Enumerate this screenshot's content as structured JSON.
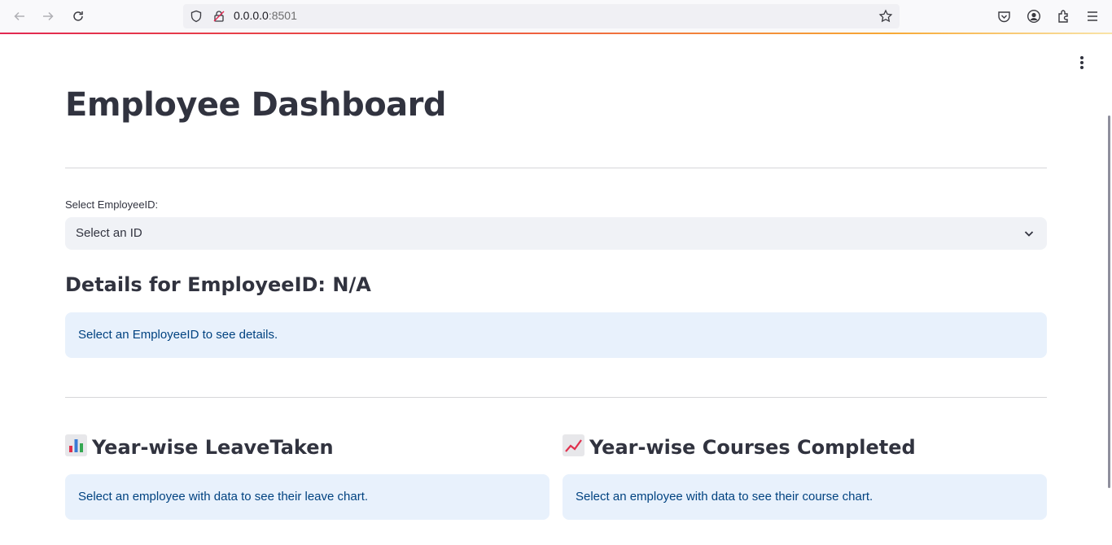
{
  "browser": {
    "url_host": "0.0.0.0",
    "url_port": ":8501"
  },
  "page": {
    "title": "Employee Dashboard",
    "select_label": "Select EmployeeID:",
    "select_value": "Select an ID",
    "details_heading": "Details for EmployeeID: N/A",
    "details_info": "Select an EmployeeID to see details.",
    "leave_heading": "Year-wise LeaveTaken",
    "leave_info": "Select an employee with data to see their leave chart.",
    "courses_heading": "Year-wise Courses Completed",
    "courses_info": "Select an employee with data to see their course chart."
  },
  "icons": {
    "leave_emoji": "bar-chart-emoji",
    "courses_emoji": "chart-increasing-emoji"
  },
  "colors": {
    "text": "#31333f",
    "info_bg": "#e8f1fc",
    "info_text": "#004280",
    "select_bg": "#f0f2f6"
  }
}
